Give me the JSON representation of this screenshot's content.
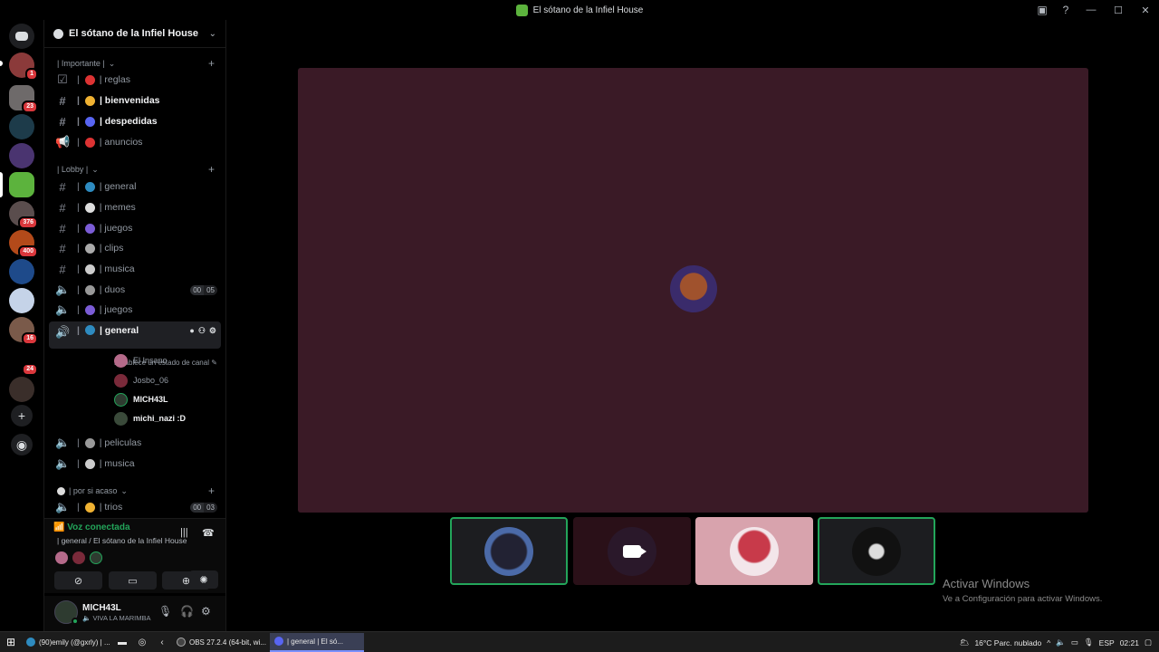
{
  "window": {
    "title": "El sótano de la Infiel House"
  },
  "rail": {
    "badges": [
      "1",
      "23",
      "376",
      "400",
      "16",
      "24"
    ]
  },
  "server": {
    "name": "El sótano de la Infiel House"
  },
  "categories": {
    "importante": "| Importante |",
    "lobby": "| Lobby |",
    "por_si_acaso": "| por si acaso"
  },
  "channels": {
    "reglas": "| reglas",
    "bienvenidas": "| bienvenidas",
    "despedidas": "| despedidas",
    "anuncios": "| anuncios",
    "general_text": "| general",
    "memes": "| memes",
    "juegos_text": "| juegos",
    "clips": "| clips",
    "musica_text": "| musica",
    "duos": "| duos",
    "juegos_voice": "| juegos",
    "general_voice": "| general",
    "peliculas": "| peliculas",
    "musica_voice": "| musica",
    "trios": "| trios"
  },
  "counters": {
    "duos": [
      "00",
      "05"
    ],
    "trios": [
      "00",
      "03"
    ]
  },
  "channel_status_hint": "Establece un estado de canal",
  "voice_users": [
    "El Insano",
    "Josbo_06",
    "MICH43L",
    "michi_nazi :D"
  ],
  "voice_panel": {
    "status": "Voz conectada",
    "location": "| general / El sótano de la Infiel House"
  },
  "user": {
    "name": "MICH43L",
    "status": "VIVA LA MARIMBA"
  },
  "watermark": {
    "line1": "Activar Windows",
    "line2": "Ve a Configuración para activar Windows."
  },
  "taskbar": {
    "tasks": [
      "(90)emily (@gxrly) | ...",
      "OBS 27.2.4 (64-bit, wi...",
      "| general | El só..."
    ],
    "weather": "16°C  Parc. nublado",
    "lang": "ESP",
    "time": "02:21"
  },
  "colors": {
    "main_tile": "#3a1a26",
    "speaking_border": "#23a55a",
    "badge": "#da373c",
    "tile_highlight": "#d8a3ad"
  }
}
